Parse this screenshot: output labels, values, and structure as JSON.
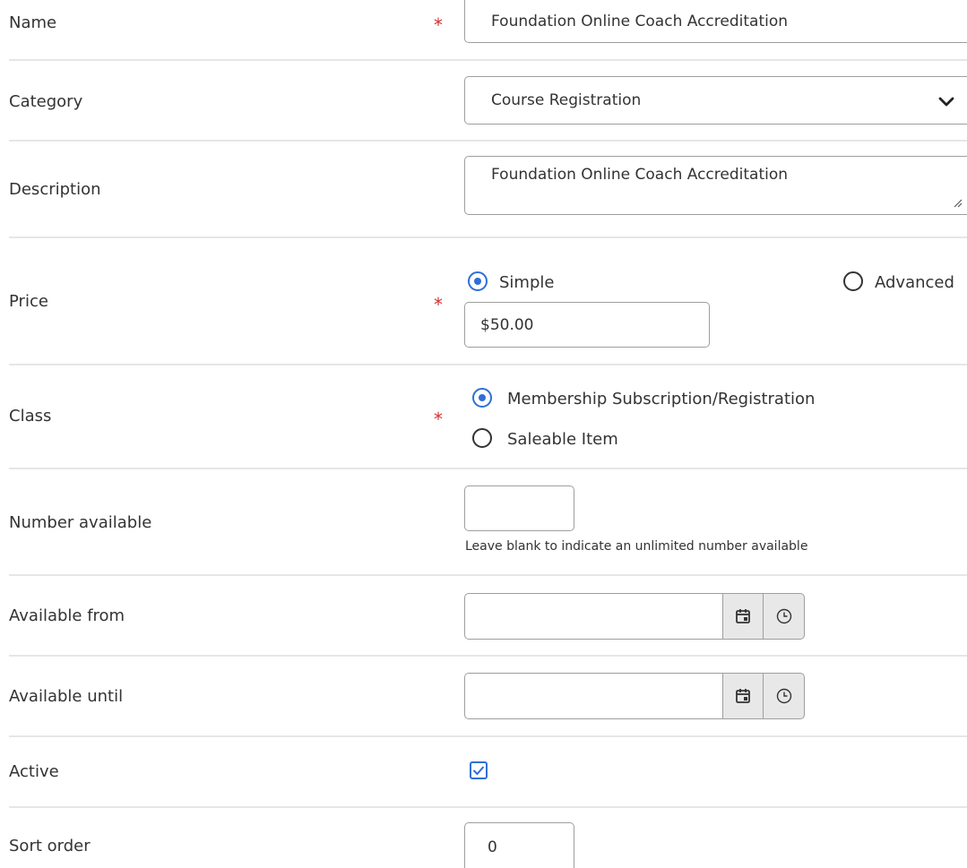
{
  "form": {
    "required_mark": "*",
    "name": {
      "label": "Name",
      "value": "Foundation Online Coach Accreditation"
    },
    "category": {
      "label": "Category",
      "value": "Course Registration",
      "icon": "chevron-down-icon"
    },
    "description": {
      "label": "Description",
      "value": "Foundation Online Coach Accreditation"
    },
    "price": {
      "label": "Price",
      "options": [
        {
          "label": "Simple",
          "selected": true
        },
        {
          "label": "Advanced",
          "selected": false
        }
      ],
      "value": "$50.00"
    },
    "class": {
      "label": "Class",
      "options": [
        {
          "label": "Membership Subscription/Registration",
          "selected": true
        },
        {
          "label": "Saleable Item",
          "selected": false
        }
      ]
    },
    "number_available": {
      "label": "Number available",
      "value": "",
      "hint": "Leave blank to indicate an unlimited number available"
    },
    "available_from": {
      "label": "Available from",
      "value": "",
      "icons": [
        "calendar-icon",
        "clock-icon"
      ]
    },
    "available_until": {
      "label": "Available until",
      "value": "",
      "icons": [
        "calendar-icon",
        "clock-icon"
      ]
    },
    "active": {
      "label": "Active",
      "checked": true
    },
    "sort_order": {
      "label": "Sort order",
      "value": "0"
    }
  },
  "colors": {
    "accent": "#2f6fd6",
    "required": "#d32f2f",
    "divider": "#e6e6e6",
    "border": "#9e9e9e",
    "addon_bg": "#e8e8e8"
  }
}
